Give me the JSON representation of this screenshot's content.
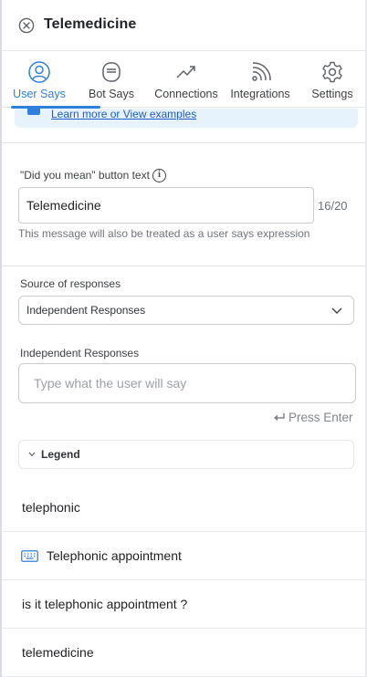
{
  "header": {
    "title": "Telemedicine"
  },
  "tabs": [
    {
      "label": "User Says",
      "icon": "user-icon",
      "active": true
    },
    {
      "label": "Bot Says",
      "icon": "bot-icon",
      "active": false
    },
    {
      "label": "Connections",
      "icon": "trend-icon",
      "active": false
    },
    {
      "label": "Integrations",
      "icon": "broadcast-icon",
      "active": false
    },
    {
      "label": "Settings",
      "icon": "gear-icon",
      "active": false
    }
  ],
  "banner": {
    "link": "Learn more or View examples"
  },
  "did_you_mean": {
    "label": "\"Did you mean\" button text",
    "value": "Telemedicine",
    "counter": "16/20",
    "hint": "This message will also be treated as a user says expression"
  },
  "source": {
    "label": "Source of responses",
    "selected": "Independent Responses"
  },
  "independent": {
    "label": "Independent Responses",
    "placeholder": "Type what the user will say",
    "press_enter": "Press Enter"
  },
  "legend": {
    "label": "Legend"
  },
  "expressions": [
    {
      "text": "telephonic",
      "icon": ""
    },
    {
      "text": "Telephonic appointment",
      "icon": "keyboard-icon"
    },
    {
      "text": "is it telephonic appointment ?",
      "icon": ""
    },
    {
      "text": "telemedicine",
      "icon": ""
    }
  ],
  "colors": {
    "accent": "#2f7fde",
    "banner": "#e7f3fc",
    "link": "#1a5bc8"
  }
}
